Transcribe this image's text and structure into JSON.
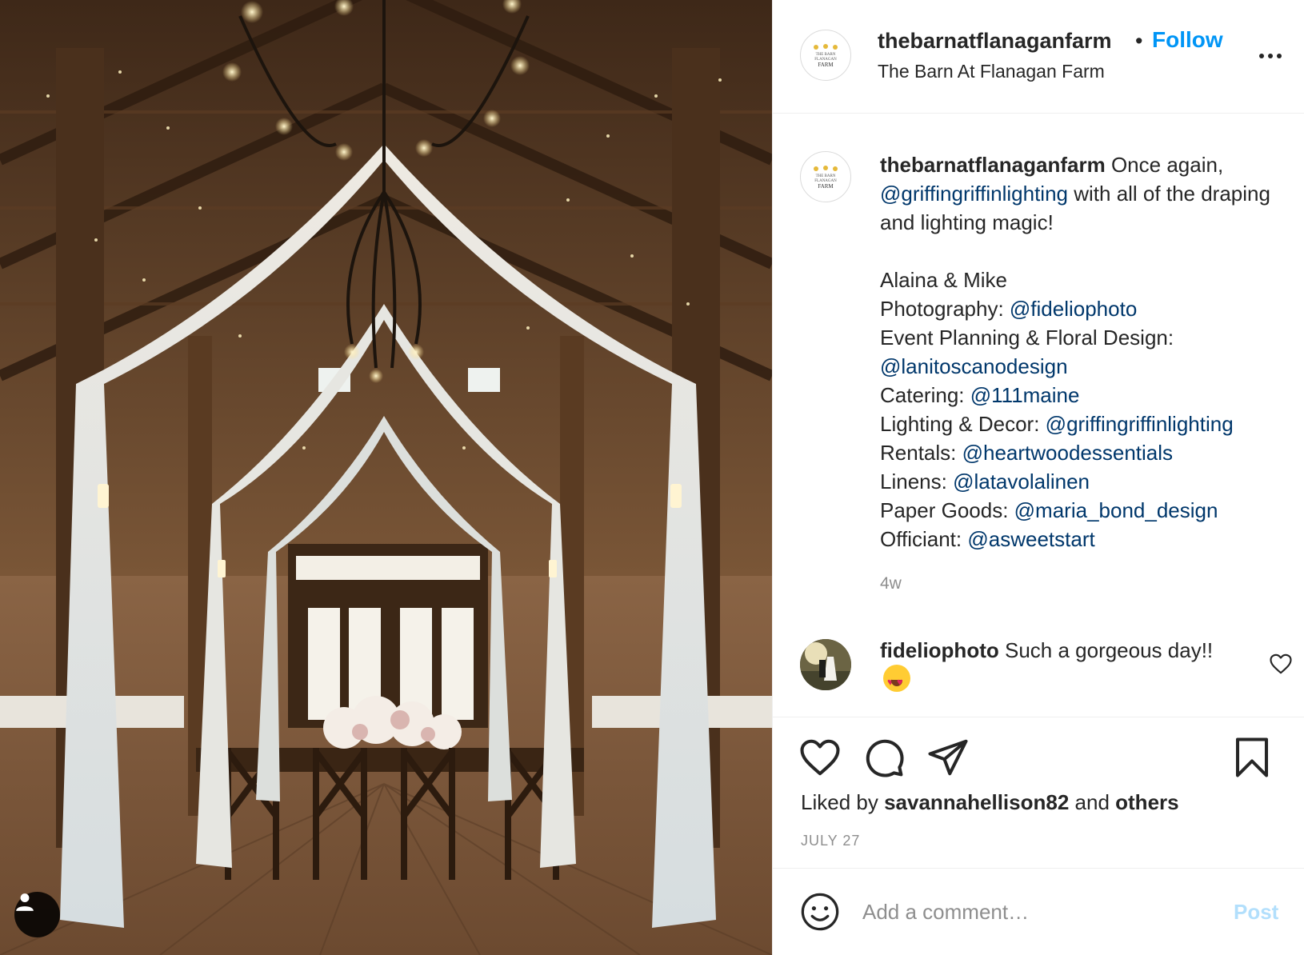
{
  "post": {
    "account": {
      "username": "thebarnatflanaganfarm",
      "separator": "•",
      "follow_label": "Follow",
      "location": "The Barn At Flanagan Farm",
      "logo_text": [
        "THE BARN",
        "FLANAGAN",
        "FARM"
      ]
    },
    "photo": {
      "description_icon": "user-tag-icon"
    },
    "caption": {
      "username": "thebarnatflanaganfarm",
      "intro": " Once again, ",
      "intro_mention": "@griffingriffinlighting",
      "intro_rest": " with all of the draping and lighting magic!",
      "couple": "Alaina & Mike",
      "credits": [
        {
          "label": "Photography: ",
          "mention": "@fideliophoto"
        },
        {
          "label": "Event Planning & Floral Design: ",
          "mention": "@lanitoscanodesign"
        },
        {
          "label": "Catering: ",
          "mention": "@111maine"
        },
        {
          "label": "Lighting & Decor: ",
          "mention": "@griffingriffinlighting"
        },
        {
          "label": "Rentals: ",
          "mention": "@heartwoodessentials"
        },
        {
          "label": "Linens: ",
          "mention": "@latavolalinen"
        },
        {
          "label": "Paper Goods: ",
          "mention": "@maria_bond_design"
        },
        {
          "label": "Officiant: ",
          "mention": "@asweetstart"
        }
      ],
      "time_ago": "4w"
    },
    "reply": {
      "username": "fideliophoto",
      "text": " Such a gorgeous day!! ",
      "emoji": "heart-eyes-emoji"
    },
    "actions": {
      "icons": [
        "heart-icon",
        "comment-icon",
        "share-icon",
        "bookmark-icon"
      ],
      "liked_prefix": "Liked by ",
      "liked_user": "savannahellison82",
      "liked_middle": " and ",
      "liked_others": "others",
      "date": "JULY 27"
    },
    "comment_box": {
      "placeholder": "Add a comment…",
      "post_label": "Post"
    }
  },
  "colors": {
    "link": "#0095f6",
    "mention": "#00376b",
    "muted": "#8e8e8e",
    "post_disabled": "#b2dffc",
    "text": "#262626"
  }
}
